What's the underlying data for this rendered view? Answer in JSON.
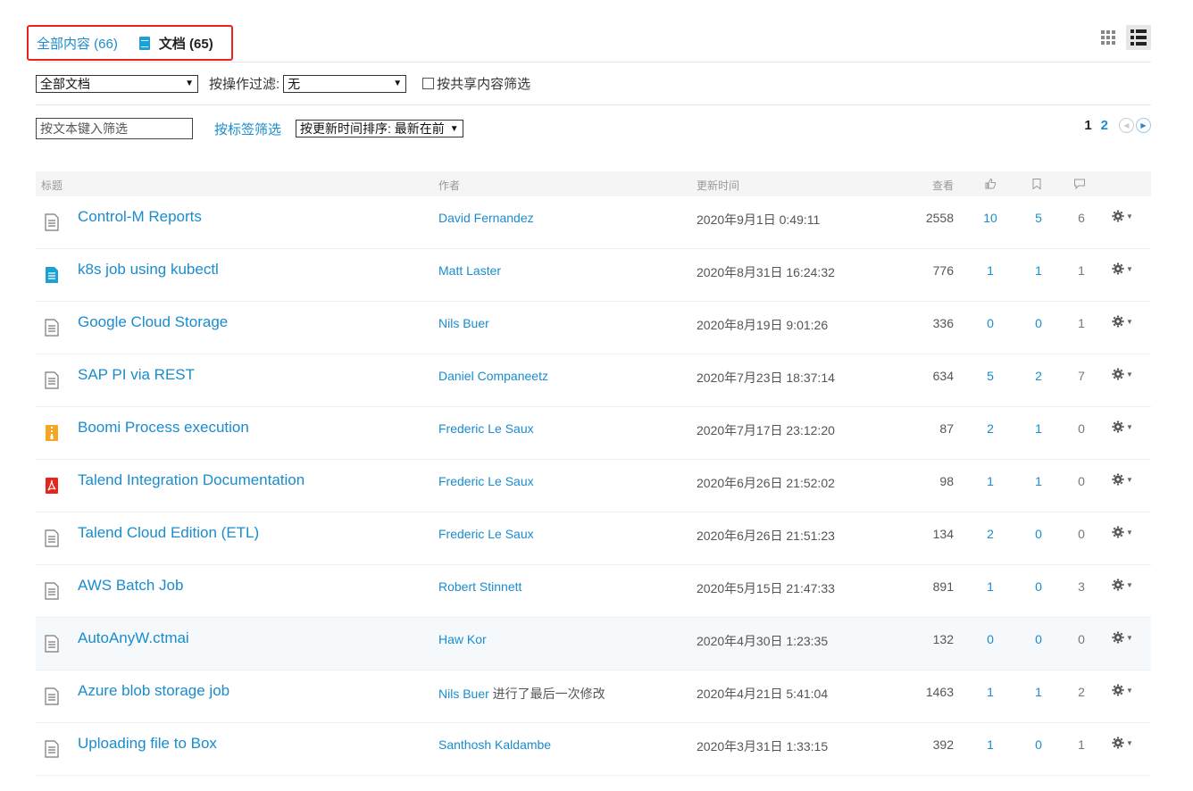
{
  "tabs": {
    "all_label": "全部内容 (66)",
    "docs_label": "文档 (65)"
  },
  "filters": {
    "doc_type": "全部文档",
    "action_filter_label": "按操作过滤:",
    "action_filter_value": "无",
    "shared_label": "按共享内容筛选",
    "text_placeholder": "按文本键入筛选",
    "tag_filter": "按标签筛选",
    "sort": "按更新时间排序: 最新在前"
  },
  "pagination": {
    "current": "1",
    "next": "2"
  },
  "columns": {
    "title": "标题",
    "author": "作者",
    "updated": "更新时间",
    "views": "查看"
  },
  "colors": {
    "link": "#1a8ccd",
    "highlight_border": "#e8241c"
  },
  "rows": [
    {
      "icon": "generic",
      "title": "Control-M Reports",
      "author": "David Fernandez",
      "note": "",
      "date": "2020年9月1日 0:49:11",
      "views": "2558",
      "likes": "10",
      "bookmarks": "5",
      "comments": "6"
    },
    {
      "icon": "doc-blue",
      "title": "k8s job using kubectl",
      "author": "Matt Laster",
      "note": "",
      "date": "2020年8月31日 16:24:32",
      "views": "776",
      "likes": "1",
      "bookmarks": "1",
      "comments": "1"
    },
    {
      "icon": "generic",
      "title": "Google Cloud Storage",
      "author": "Nils Buer",
      "note": "",
      "date": "2020年8月19日 9:01:26",
      "views": "336",
      "likes": "0",
      "bookmarks": "0",
      "comments": "1"
    },
    {
      "icon": "generic",
      "title": "SAP PI via REST",
      "author": "Daniel Companeetz",
      "note": "",
      "date": "2020年7月23日 18:37:14",
      "views": "634",
      "likes": "5",
      "bookmarks": "2",
      "comments": "7"
    },
    {
      "icon": "zip",
      "title": "Boomi Process execution",
      "author": "Frederic Le Saux",
      "note": "",
      "date": "2020年7月17日 23:12:20",
      "views": "87",
      "likes": "2",
      "bookmarks": "1",
      "comments": "0"
    },
    {
      "icon": "pdf",
      "title": "Talend Integration Documentation",
      "author": "Frederic Le Saux",
      "note": "",
      "date": "2020年6月26日 21:52:02",
      "views": "98",
      "likes": "1",
      "bookmarks": "1",
      "comments": "0"
    },
    {
      "icon": "generic",
      "title": "Talend Cloud Edition (ETL)",
      "author": "Frederic Le Saux",
      "note": "",
      "date": "2020年6月26日 21:51:23",
      "views": "134",
      "likes": "2",
      "bookmarks": "0",
      "comments": "0"
    },
    {
      "icon": "generic",
      "title": "AWS Batch Job",
      "author": "Robert Stinnett",
      "note": "",
      "date": "2020年5月15日 21:47:33",
      "views": "891",
      "likes": "1",
      "bookmarks": "0",
      "comments": "3"
    },
    {
      "icon": "generic",
      "title": "AutoAnyW.ctmai",
      "author": "Haw Kor",
      "note": "",
      "date": "2020年4月30日 1:23:35",
      "views": "132",
      "likes": "0",
      "bookmarks": "0",
      "comments": "0"
    },
    {
      "icon": "generic",
      "title": "Azure blob storage job",
      "author": "Nils Buer",
      "note": " 进行了最后一次修改",
      "date": "2020年4月21日 5:41:04",
      "views": "1463",
      "likes": "1",
      "bookmarks": "1",
      "comments": "2"
    },
    {
      "icon": "generic",
      "title": "Uploading file to Box",
      "author": "Santhosh Kaldambe",
      "note": "",
      "date": "2020年3月31日 1:33:15",
      "views": "392",
      "likes": "1",
      "bookmarks": "0",
      "comments": "1"
    }
  ]
}
